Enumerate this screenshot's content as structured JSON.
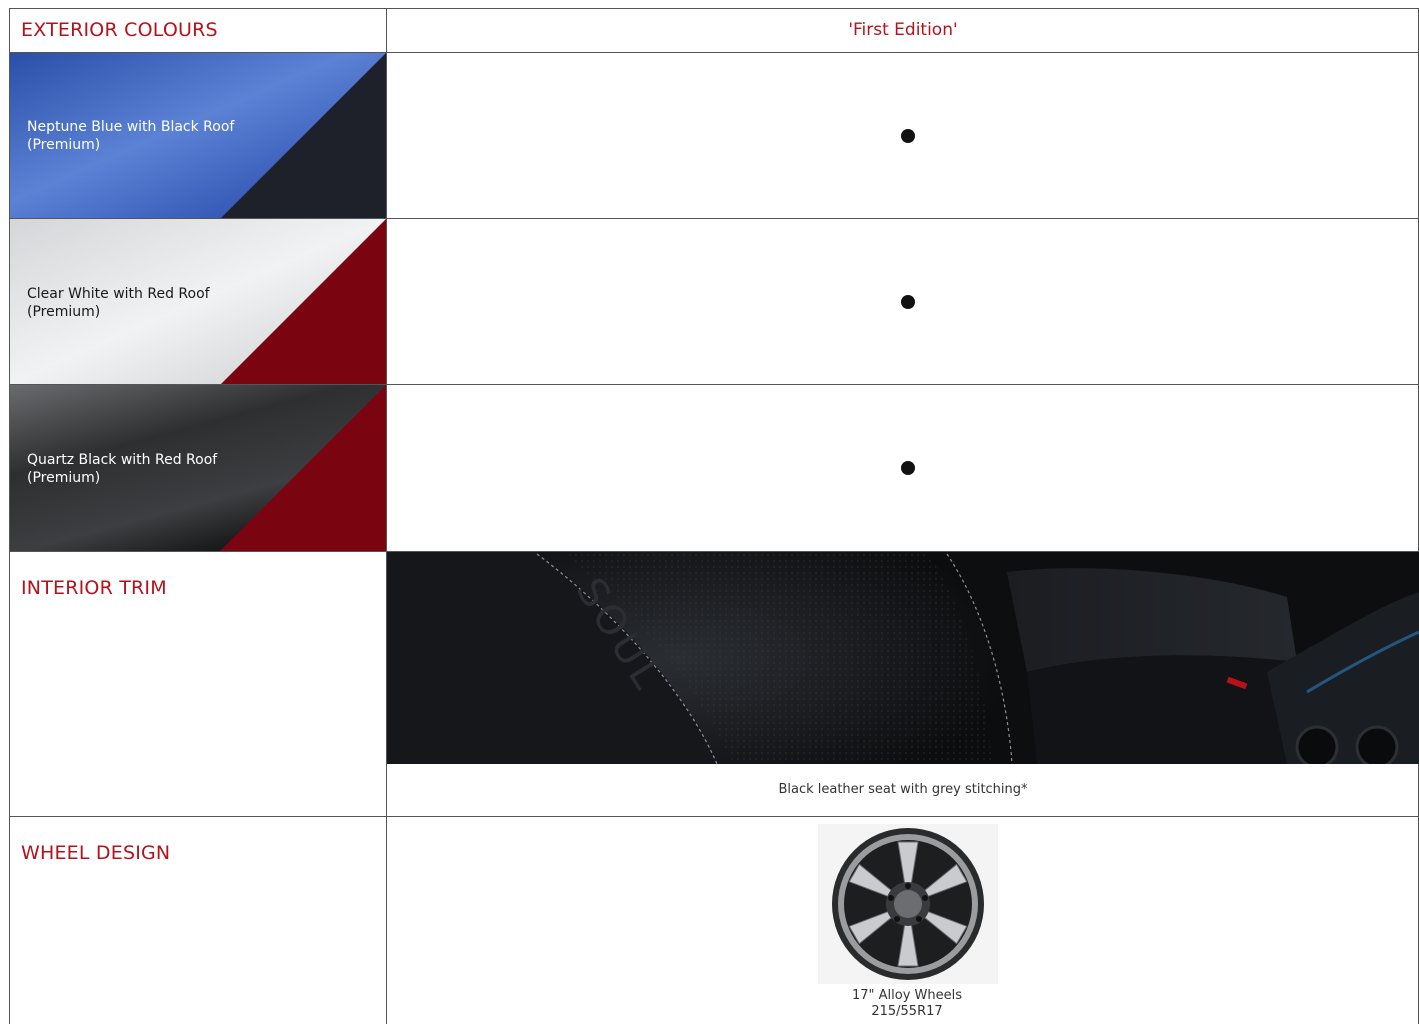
{
  "header": {
    "exterior_title": "EXTERIOR COLOURS",
    "column_title": "'First Edition'"
  },
  "exterior_colours": [
    {
      "line1": "Neptune Blue with Black Roof",
      "line2": "(Premium)",
      "available": true,
      "body_color": "#2f55b0",
      "roof_color": "#1e2129"
    },
    {
      "line1": "Clear White with Red Roof",
      "line2": "(Premium)",
      "available": true,
      "body_color": "#e6e8ea",
      "roof_color": "#7a0510"
    },
    {
      "line1": "Quartz Black with Red Roof",
      "line2": "(Premium)",
      "available": true,
      "body_color": "#2b2c2e",
      "roof_color": "#7a0510"
    }
  ],
  "interior": {
    "title": "INTERIOR TRIM",
    "caption": "Black leather seat with grey stitching*",
    "seat_embossing": "SOUL"
  },
  "wheels": {
    "title": "WHEEL DESIGN",
    "caption_line1": "17\" Alloy Wheels",
    "caption_line2": "215/55R17"
  },
  "colors": {
    "accent": "#b5121b",
    "grid": "#555555"
  }
}
